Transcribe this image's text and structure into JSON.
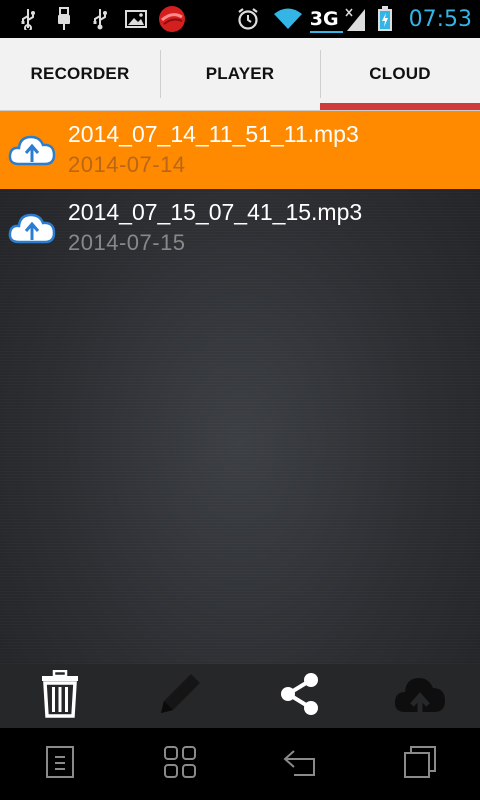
{
  "status_bar": {
    "time": "07:53",
    "network": "3G",
    "icons": [
      "usb-icon",
      "usb-plug-icon",
      "usb-icon",
      "image-icon",
      "app-red-icon",
      "alarm-icon",
      "wifi-icon",
      "signal-icon",
      "battery-charging-icon"
    ],
    "accent_color": "#33b5e5"
  },
  "tabs": [
    {
      "label": "RECORDER",
      "active": false
    },
    {
      "label": "PLAYER",
      "active": false
    },
    {
      "label": "CLOUD",
      "active": true
    }
  ],
  "files": [
    {
      "name": "2014_07_14_11_51_11.mp3",
      "date": "2014-07-14",
      "selected": true,
      "icon": "cloud-upload-icon"
    },
    {
      "name": "2014_07_15_07_41_15.mp3",
      "date": "2014-07-15",
      "selected": false,
      "icon": "cloud-upload-icon"
    }
  ],
  "actions": [
    "delete-icon",
    "edit-icon",
    "share-icon",
    "cloud-upload-icon"
  ],
  "nav": [
    "menu-icon",
    "apps-icon",
    "back-icon",
    "recents-icon"
  ],
  "colors": {
    "selected_row": "#ff8a00",
    "tab_indicator": "#cf3b3b"
  }
}
